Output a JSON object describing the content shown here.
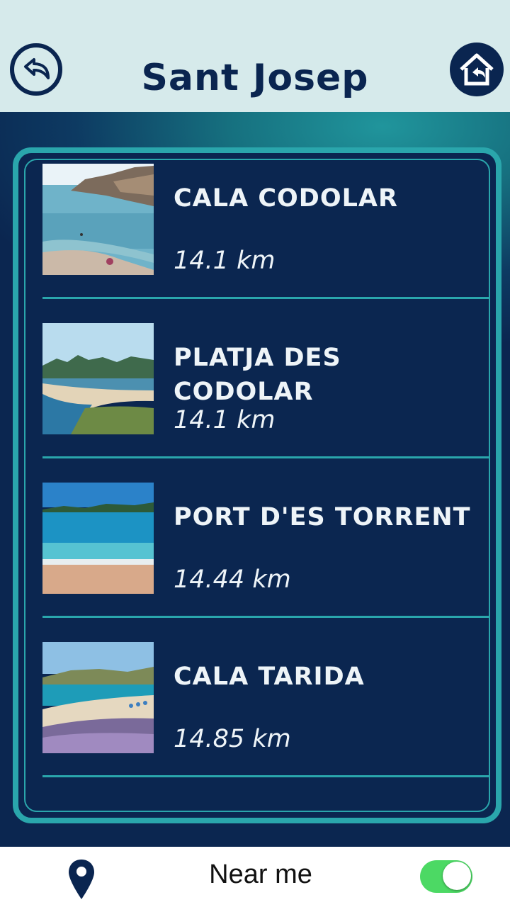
{
  "header": {
    "title": "Sant Josep",
    "back_icon": "back-arrow-icon",
    "home_icon": "home-icon"
  },
  "beaches": [
    {
      "name": "CALA CODOLAR",
      "distance": "14.1 km",
      "image": "beach-cove-photo"
    },
    {
      "name": "PLATJA DES CODOLAR",
      "distance": "14.1 km",
      "image": "beach-sandbar-photo"
    },
    {
      "name": "PORT D'ES TORRENT",
      "distance": "14.44 km",
      "image": "beach-turquoise-photo"
    },
    {
      "name": "CALA TARIDA",
      "distance": "14.85 km",
      "image": "beach-flowers-photo"
    }
  ],
  "footer": {
    "label": "Near me",
    "pin_icon": "location-pin-icon",
    "toggle_on": true
  },
  "colors": {
    "navy": "#0a2550",
    "teal": "#2aa6ac",
    "header_bg": "#d6eaeb",
    "toggle_green": "#4cd964"
  }
}
